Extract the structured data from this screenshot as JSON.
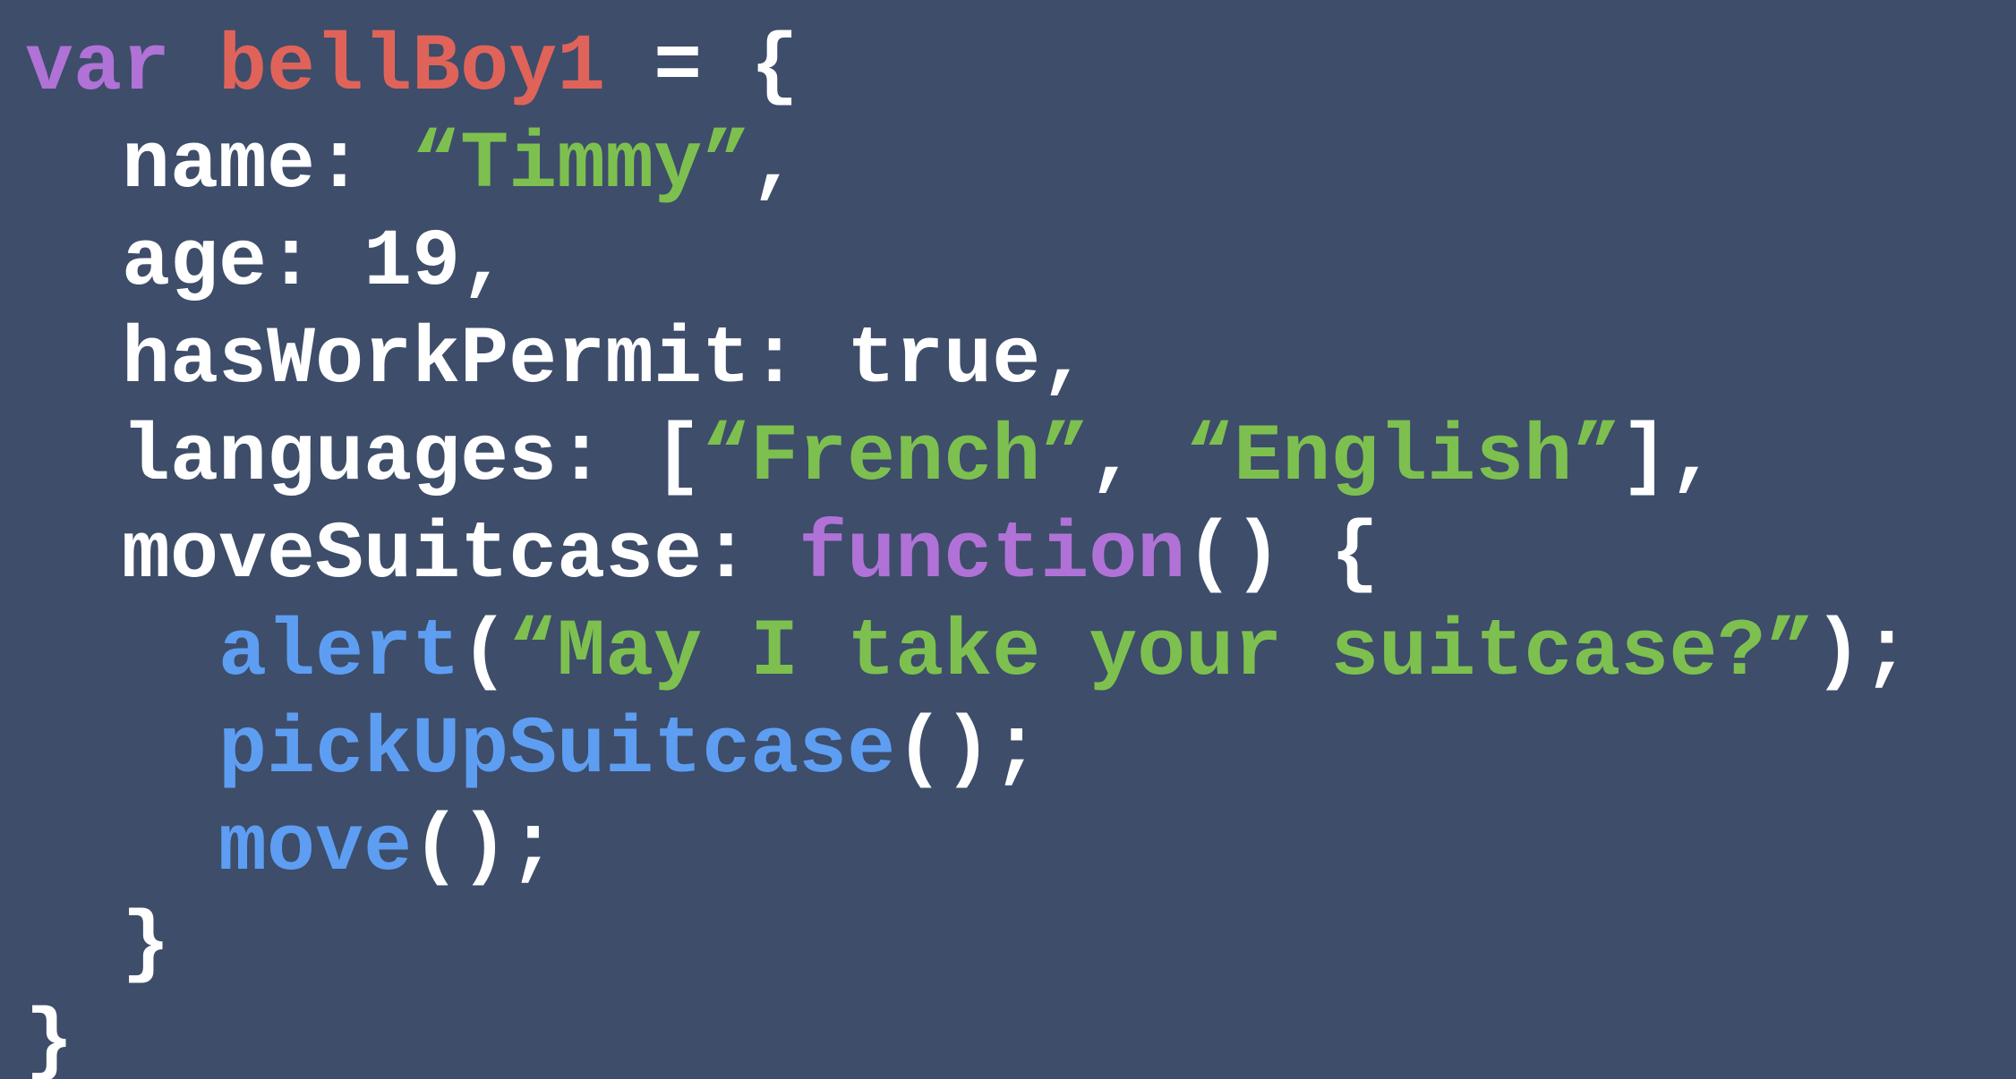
{
  "colors": {
    "background": "#3d4d6a",
    "keyword": "#b072d6",
    "variable": "#e0635a",
    "plain": "#ffffff",
    "string": "#7ec04f",
    "function": "#5e9ef2"
  },
  "code": {
    "lines": [
      {
        "indent": 0,
        "tokens": [
          {
            "t": "keyword",
            "v": "var"
          },
          {
            "t": "plain",
            "v": " "
          },
          {
            "t": "variable",
            "v": "bellBoy1"
          },
          {
            "t": "plain",
            "v": " = {"
          }
        ]
      },
      {
        "indent": 1,
        "tokens": [
          {
            "t": "plain",
            "v": "name: "
          },
          {
            "t": "string",
            "v": "“Timmy”"
          },
          {
            "t": "plain",
            "v": ","
          }
        ]
      },
      {
        "indent": 1,
        "tokens": [
          {
            "t": "plain",
            "v": "age: 19,"
          }
        ]
      },
      {
        "indent": 1,
        "tokens": [
          {
            "t": "plain",
            "v": "hasWorkPermit: true,"
          }
        ]
      },
      {
        "indent": 1,
        "tokens": [
          {
            "t": "plain",
            "v": "languages: ["
          },
          {
            "t": "string",
            "v": "“French”"
          },
          {
            "t": "plain",
            "v": ", "
          },
          {
            "t": "string",
            "v": "“English”"
          },
          {
            "t": "plain",
            "v": "],"
          }
        ]
      },
      {
        "indent": 1,
        "tokens": [
          {
            "t": "plain",
            "v": "moveSuitcase: "
          },
          {
            "t": "keyword",
            "v": "function"
          },
          {
            "t": "plain",
            "v": "() {"
          }
        ]
      },
      {
        "indent": 2,
        "tokens": [
          {
            "t": "function",
            "v": "alert"
          },
          {
            "t": "plain",
            "v": "("
          },
          {
            "t": "string",
            "v": "“May I take your suitcase?”"
          },
          {
            "t": "plain",
            "v": ");"
          }
        ]
      },
      {
        "indent": 2,
        "tokens": [
          {
            "t": "function",
            "v": "pickUpSuitcase"
          },
          {
            "t": "plain",
            "v": "();"
          }
        ]
      },
      {
        "indent": 2,
        "tokens": [
          {
            "t": "function",
            "v": "move"
          },
          {
            "t": "plain",
            "v": "();"
          }
        ]
      },
      {
        "indent": 1,
        "tokens": [
          {
            "t": "plain",
            "v": "}"
          }
        ]
      },
      {
        "indent": 0,
        "tokens": [
          {
            "t": "plain",
            "v": "}"
          }
        ]
      }
    ]
  }
}
